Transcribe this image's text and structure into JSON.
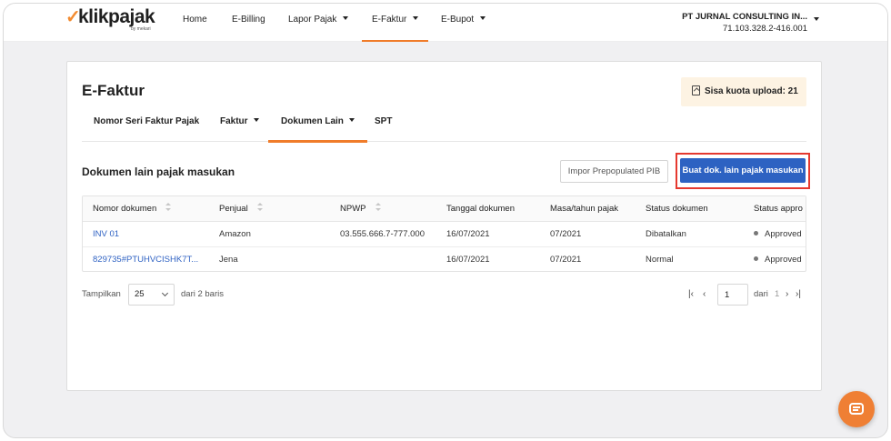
{
  "brand": {
    "name": "klikpajak",
    "check_glyph": "✓",
    "sub": "by mekari",
    "accent": "#f07c2a"
  },
  "nav": {
    "items": [
      {
        "label": "Home"
      },
      {
        "label": "E-Billing"
      },
      {
        "label": "Lapor Pajak"
      },
      {
        "label": "E-Faktur",
        "active": true
      },
      {
        "label": "E-Bupot"
      }
    ]
  },
  "company": {
    "name": "PT JURNAL CONSULTING IN...",
    "npwp": "71.103.328.2-416.001"
  },
  "page": {
    "title": "E-Faktur",
    "quota_label": "Sisa kuota upload: 21"
  },
  "tabs": [
    {
      "label": "Nomor Seri Faktur Pajak"
    },
    {
      "label": "Faktur"
    },
    {
      "label": "Dokumen Lain",
      "active": true
    },
    {
      "label": "SPT"
    }
  ],
  "section": {
    "title": "Dokumen lain pajak masukan",
    "import_button": "Impor Prepopulated PIB",
    "create_button": "Buat dok. lain pajak masukan",
    "create_button_color": "#2d62c2",
    "highlight_color": "#e5392f"
  },
  "table": {
    "columns": [
      "Nomor dokumen",
      "Penjual",
      "NPWP",
      "Tanggal dokumen",
      "Masa/tahun pajak",
      "Status dokumen",
      "Status appro"
    ],
    "rows": [
      {
        "nomor": "INV 01",
        "penjual": "Amazon",
        "npwp": "03.555.666.7-777.000",
        "tanggal": "16/07/2021",
        "masa": "07/2021",
        "status": "Dibatalkan",
        "approval": "Approved"
      },
      {
        "nomor": "829735#PTUHVCISHK7T...",
        "penjual": "Jena",
        "npwp": "",
        "tanggal": "16/07/2021",
        "masa": "07/2021",
        "status": "Normal",
        "approval": "Approved"
      }
    ]
  },
  "pagination": {
    "show_label": "Tampilkan",
    "page_size": "25",
    "total_label": "dari 2 baris",
    "current_page": "1",
    "of_label": "dari",
    "total_pages": "1",
    "first_glyph": "|‹",
    "prev_glyph": "‹",
    "next_glyph": "›",
    "last_glyph": "›|"
  }
}
